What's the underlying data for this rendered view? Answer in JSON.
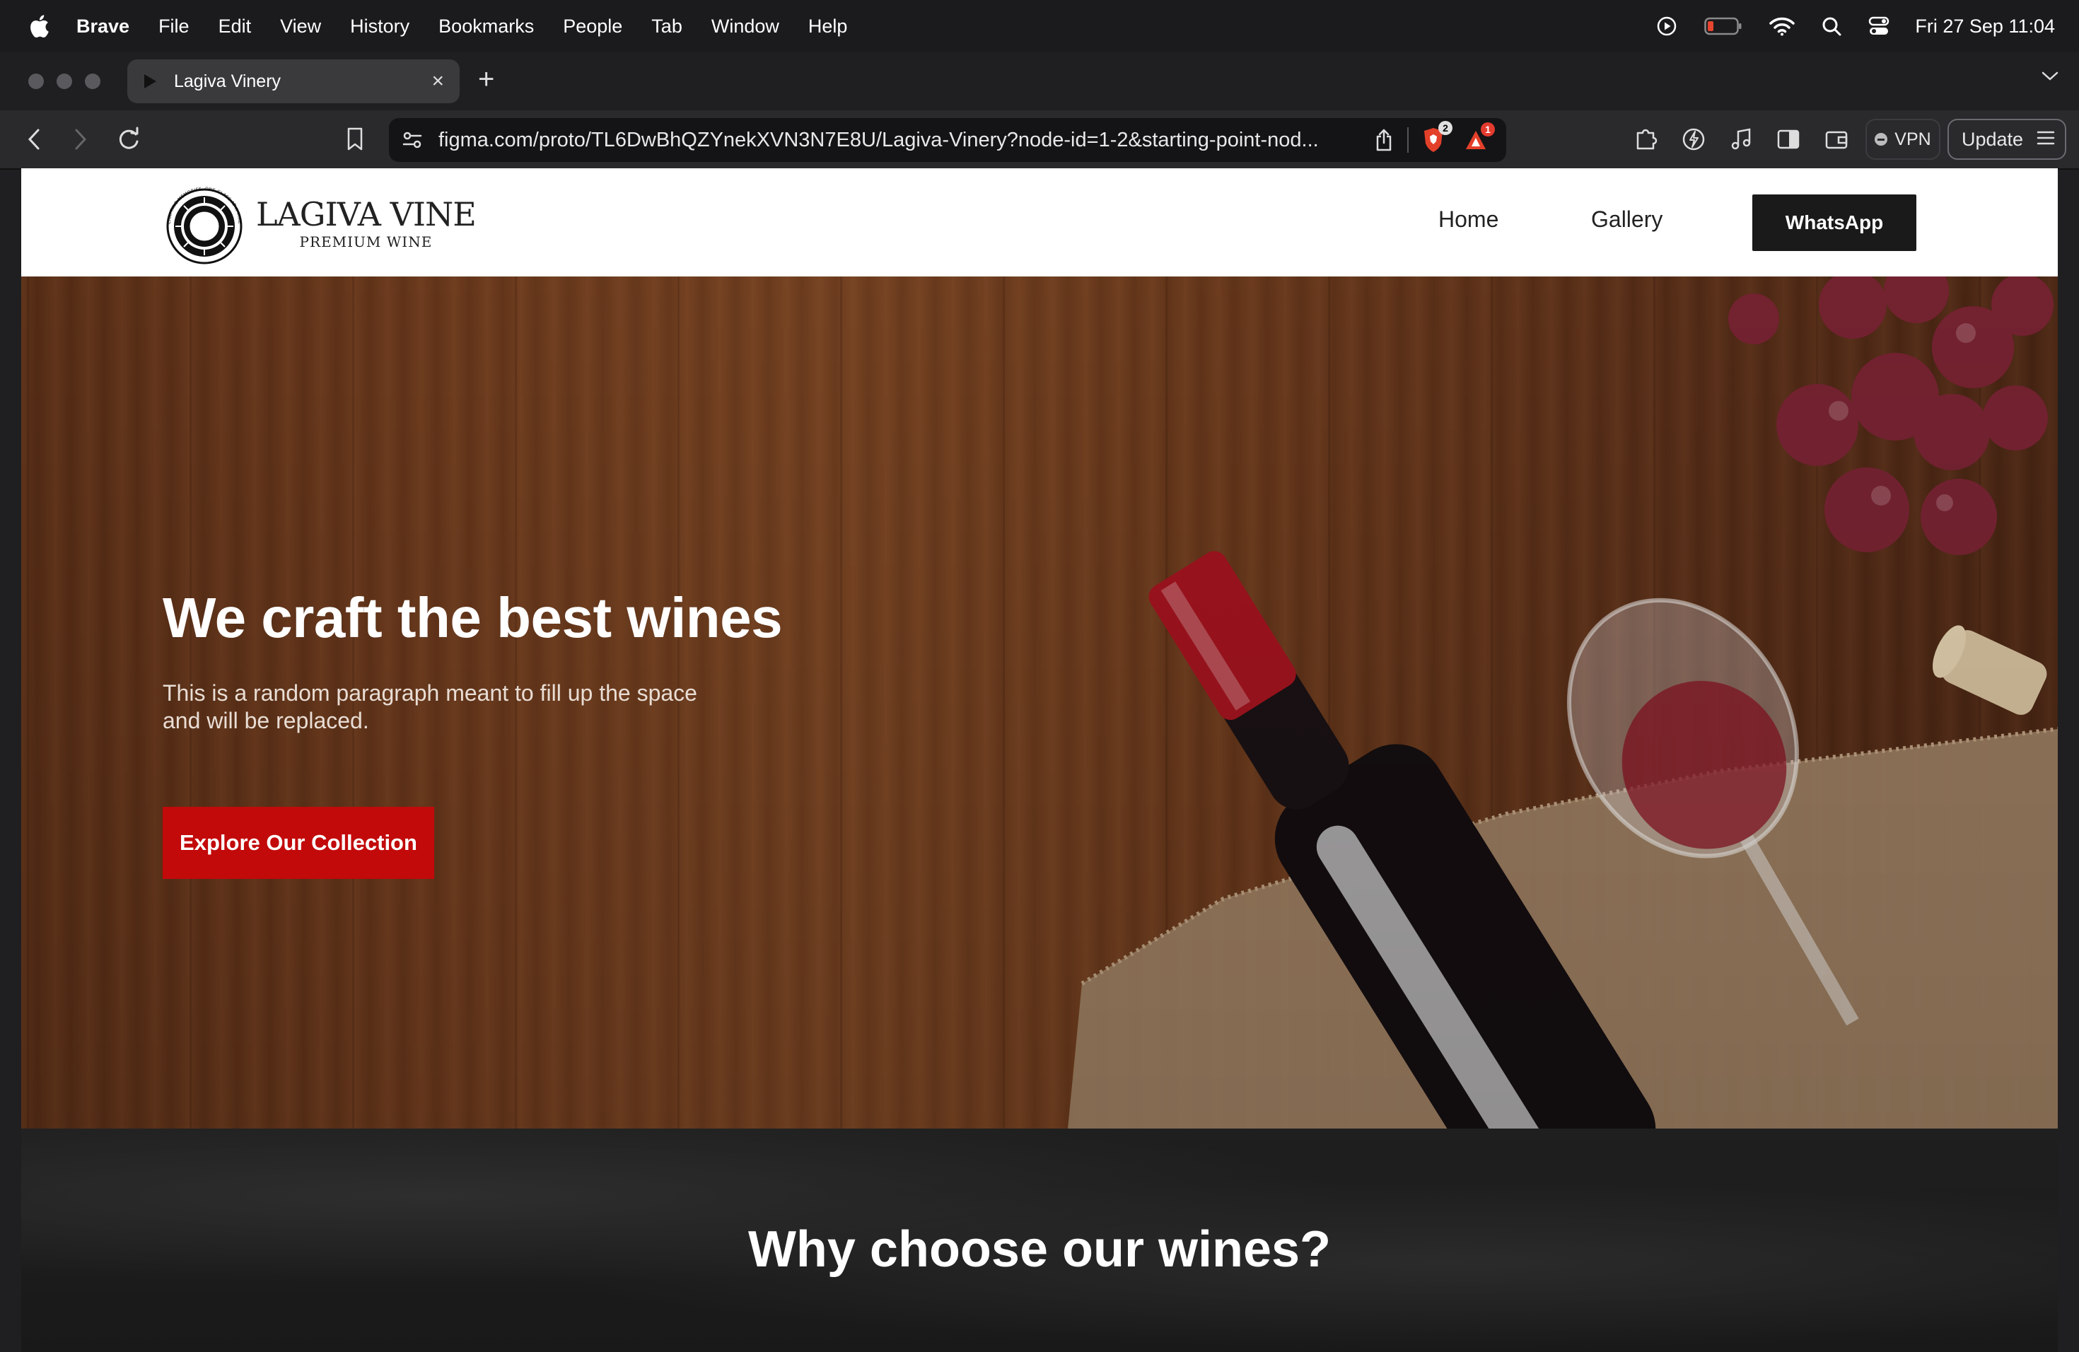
{
  "menubar": {
    "app_name": "Brave",
    "items": [
      "File",
      "Edit",
      "View",
      "History",
      "Bookmarks",
      "People",
      "Tab",
      "Window",
      "Help"
    ],
    "clock": "Fri 27 Sep  11:04",
    "status_icons": [
      "play-circle-icon",
      "battery-icon",
      "wifi-icon",
      "search-icon",
      "control-center-icon"
    ]
  },
  "browser": {
    "tab": {
      "title": "Lagiva Vinery",
      "favicon": "play-triangle-icon"
    },
    "url": "figma.com/proto/TL6DwBhQZYnekXVN3N7E8U/Lagiva-Vinery?node-id=1-2&starting-point-nod...",
    "shield_badge": "2",
    "rewards_badge": "1",
    "vpn_label": "VPN",
    "update_label": "Update"
  },
  "site": {
    "logo": {
      "name": "LAGIVA VINE",
      "subtitle": "PREMIUM WINE",
      "ring_text": "CRAFTING MEMORIES, ONE GLASS AT A TIME"
    },
    "nav": {
      "home": "Home",
      "gallery": "Gallery",
      "whatsapp": "WhatsApp"
    },
    "hero": {
      "title": "We craft the best wines",
      "text": "This is a random paragraph meant to fill up the space and will be replaced.",
      "cta": "Explore Our Collection"
    },
    "why": {
      "title": "Why choose our wines?"
    }
  },
  "colors": {
    "accent_red": "#c20a0a",
    "dark_button": "#1a1a1a",
    "wood": "#6f3b1d",
    "dark_section": "#1d1d1d"
  }
}
